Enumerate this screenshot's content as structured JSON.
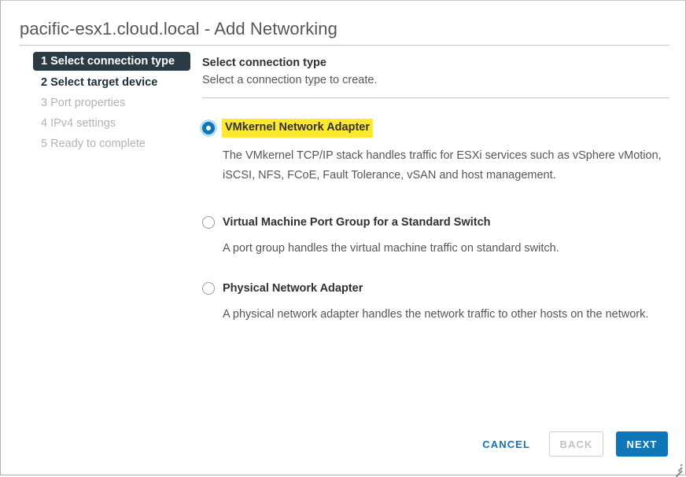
{
  "dialog": {
    "title": "pacific-esx1.cloud.local - Add Networking"
  },
  "steps": [
    {
      "label": "1 Select connection type",
      "state": "active"
    },
    {
      "label": "2 Select target device",
      "state": "done"
    },
    {
      "label": "3 Port properties",
      "state": "upcoming"
    },
    {
      "label": "4 IPv4 settings",
      "state": "upcoming"
    },
    {
      "label": "5 Ready to complete",
      "state": "upcoming"
    }
  ],
  "content": {
    "title": "Select connection type",
    "subtitle": "Select a connection type to create."
  },
  "options": [
    {
      "label": "VMkernel Network Adapter",
      "description": "The VMkernel TCP/IP stack handles traffic for ESXi services such as vSphere vMotion, iSCSI, NFS, FCoE, Fault Tolerance, vSAN and host management.",
      "selected": true,
      "highlighted": true
    },
    {
      "label": "Virtual Machine Port Group for a Standard Switch",
      "description": "A port group handles the virtual machine traffic on standard switch.",
      "selected": false,
      "highlighted": false
    },
    {
      "label": "Physical Network Adapter",
      "description": "A physical network adapter handles the network traffic to other hosts on the network.",
      "selected": false,
      "highlighted": false
    }
  ],
  "footer": {
    "cancel_label": "CANCEL",
    "back_label": "BACK",
    "next_label": "NEXT"
  },
  "colors": {
    "accent_blue": "#0f76b8",
    "active_step_bg": "#2b3b46",
    "highlight_yellow": "#ffe92f",
    "text_dark": "#313131",
    "text_muted": "#565656",
    "text_disabled": "#b3b3b3"
  }
}
